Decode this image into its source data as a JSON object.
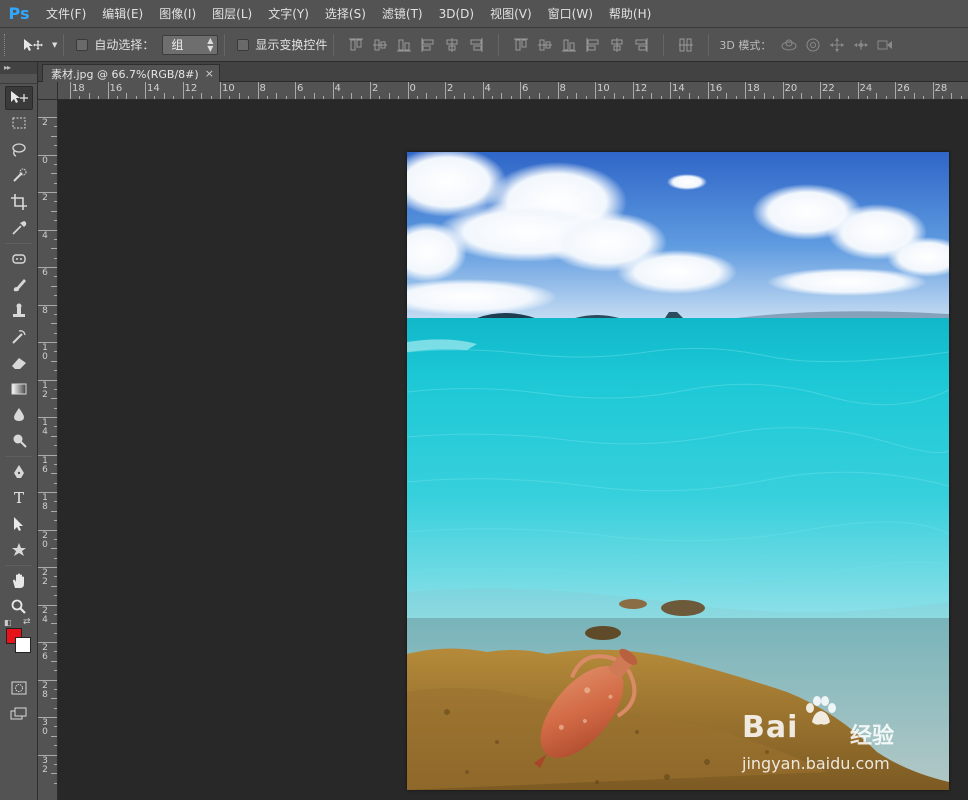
{
  "app": {
    "logo": "Ps",
    "menu": [
      "文件(F)",
      "编辑(E)",
      "图像(I)",
      "图层(L)",
      "文字(Y)",
      "选择(S)",
      "滤镜(T)",
      "3D(D)",
      "视图(V)",
      "窗口(W)",
      "帮助(H)"
    ]
  },
  "options_bar": {
    "tool_icon": "move-tool-icon",
    "auto_select_label": "自动选择：",
    "auto_select_checked": false,
    "auto_select_target": "组",
    "show_transform_label": "显示变换控件",
    "show_transform_checked": false,
    "mode_3d_label": "3D 模式："
  },
  "document": {
    "tab_title": "素材.jpg @ 66.7%(RGB/8#)",
    "close_label": "×"
  },
  "rulers": {
    "horizontal": [
      "18",
      "16",
      "14",
      "12",
      "10",
      "8",
      "6",
      "4",
      "2",
      "0",
      "2",
      "4",
      "6",
      "8",
      "10",
      "12",
      "14",
      "16",
      "18",
      "20",
      "22",
      "24",
      "26",
      "28"
    ],
    "vertical": [
      "2",
      "0",
      "2",
      "4",
      "6",
      "8",
      "10",
      "12",
      "14",
      "16",
      "18",
      "20",
      "22",
      "24",
      "26",
      "28",
      "30",
      "32"
    ]
  },
  "toolbox": {
    "tools": [
      {
        "name": "move-tool-icon",
        "active": true
      },
      {
        "name": "rectangular-marquee-tool-icon",
        "active": false
      },
      {
        "name": "lasso-tool-icon",
        "active": false
      },
      {
        "name": "quick-selection-tool-icon",
        "active": false
      },
      {
        "name": "crop-tool-icon",
        "active": false
      },
      {
        "name": "eyedropper-tool-icon",
        "active": false
      },
      {
        "name": "spot-healing-brush-tool-icon",
        "active": false
      },
      {
        "name": "brush-tool-icon",
        "active": false
      },
      {
        "name": "clone-stamp-tool-icon",
        "active": false
      },
      {
        "name": "history-brush-tool-icon",
        "active": false
      },
      {
        "name": "eraser-tool-icon",
        "active": false
      },
      {
        "name": "gradient-tool-icon",
        "active": false
      },
      {
        "name": "blur-tool-icon",
        "active": false
      },
      {
        "name": "dodge-tool-icon",
        "active": false
      },
      {
        "name": "pen-tool-icon",
        "active": false
      },
      {
        "name": "type-tool-icon",
        "active": false
      },
      {
        "name": "path-selection-tool-icon",
        "active": false
      },
      {
        "name": "custom-shape-tool-icon",
        "active": false
      },
      {
        "name": "hand-tool-icon",
        "active": false
      },
      {
        "name": "zoom-tool-icon",
        "active": false
      }
    ],
    "foreground_color": "#e8131a",
    "background_color": "#ffffff"
  },
  "watermark": {
    "brand": "Bai",
    "brand_suffix": "经验",
    "url": "jingyan.baidu.com"
  },
  "colors": {
    "accent": "#31a8ff",
    "panel": "#535353",
    "workspace": "#282828"
  }
}
